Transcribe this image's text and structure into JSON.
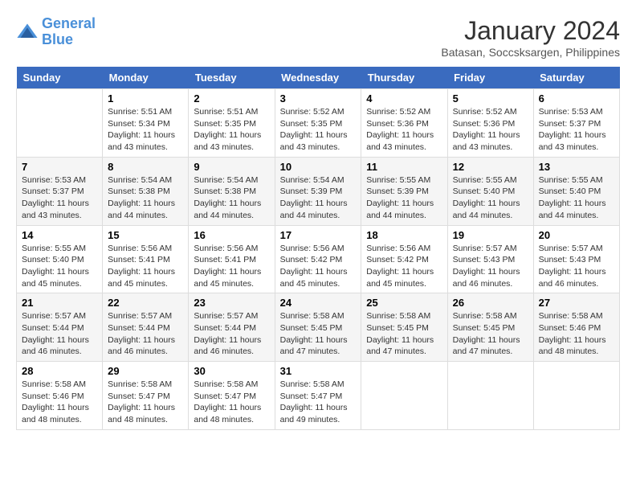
{
  "logo": {
    "line1": "General",
    "line2": "Blue"
  },
  "title": "January 2024",
  "subtitle": "Batasan, Soccsksargen, Philippines",
  "days_header": [
    "Sunday",
    "Monday",
    "Tuesday",
    "Wednesday",
    "Thursday",
    "Friday",
    "Saturday"
  ],
  "weeks": [
    [
      {
        "num": "",
        "info": ""
      },
      {
        "num": "1",
        "info": "Sunrise: 5:51 AM\nSunset: 5:34 PM\nDaylight: 11 hours\nand 43 minutes."
      },
      {
        "num": "2",
        "info": "Sunrise: 5:51 AM\nSunset: 5:35 PM\nDaylight: 11 hours\nand 43 minutes."
      },
      {
        "num": "3",
        "info": "Sunrise: 5:52 AM\nSunset: 5:35 PM\nDaylight: 11 hours\nand 43 minutes."
      },
      {
        "num": "4",
        "info": "Sunrise: 5:52 AM\nSunset: 5:36 PM\nDaylight: 11 hours\nand 43 minutes."
      },
      {
        "num": "5",
        "info": "Sunrise: 5:52 AM\nSunset: 5:36 PM\nDaylight: 11 hours\nand 43 minutes."
      },
      {
        "num": "6",
        "info": "Sunrise: 5:53 AM\nSunset: 5:37 PM\nDaylight: 11 hours\nand 43 minutes."
      }
    ],
    [
      {
        "num": "7",
        "info": "Sunrise: 5:53 AM\nSunset: 5:37 PM\nDaylight: 11 hours\nand 43 minutes."
      },
      {
        "num": "8",
        "info": "Sunrise: 5:54 AM\nSunset: 5:38 PM\nDaylight: 11 hours\nand 44 minutes."
      },
      {
        "num": "9",
        "info": "Sunrise: 5:54 AM\nSunset: 5:38 PM\nDaylight: 11 hours\nand 44 minutes."
      },
      {
        "num": "10",
        "info": "Sunrise: 5:54 AM\nSunset: 5:39 PM\nDaylight: 11 hours\nand 44 minutes."
      },
      {
        "num": "11",
        "info": "Sunrise: 5:55 AM\nSunset: 5:39 PM\nDaylight: 11 hours\nand 44 minutes."
      },
      {
        "num": "12",
        "info": "Sunrise: 5:55 AM\nSunset: 5:40 PM\nDaylight: 11 hours\nand 44 minutes."
      },
      {
        "num": "13",
        "info": "Sunrise: 5:55 AM\nSunset: 5:40 PM\nDaylight: 11 hours\nand 44 minutes."
      }
    ],
    [
      {
        "num": "14",
        "info": "Sunrise: 5:55 AM\nSunset: 5:40 PM\nDaylight: 11 hours\nand 45 minutes."
      },
      {
        "num": "15",
        "info": "Sunrise: 5:56 AM\nSunset: 5:41 PM\nDaylight: 11 hours\nand 45 minutes."
      },
      {
        "num": "16",
        "info": "Sunrise: 5:56 AM\nSunset: 5:41 PM\nDaylight: 11 hours\nand 45 minutes."
      },
      {
        "num": "17",
        "info": "Sunrise: 5:56 AM\nSunset: 5:42 PM\nDaylight: 11 hours\nand 45 minutes."
      },
      {
        "num": "18",
        "info": "Sunrise: 5:56 AM\nSunset: 5:42 PM\nDaylight: 11 hours\nand 45 minutes."
      },
      {
        "num": "19",
        "info": "Sunrise: 5:57 AM\nSunset: 5:43 PM\nDaylight: 11 hours\nand 46 minutes."
      },
      {
        "num": "20",
        "info": "Sunrise: 5:57 AM\nSunset: 5:43 PM\nDaylight: 11 hours\nand 46 minutes."
      }
    ],
    [
      {
        "num": "21",
        "info": "Sunrise: 5:57 AM\nSunset: 5:44 PM\nDaylight: 11 hours\nand 46 minutes."
      },
      {
        "num": "22",
        "info": "Sunrise: 5:57 AM\nSunset: 5:44 PM\nDaylight: 11 hours\nand 46 minutes."
      },
      {
        "num": "23",
        "info": "Sunrise: 5:57 AM\nSunset: 5:44 PM\nDaylight: 11 hours\nand 46 minutes."
      },
      {
        "num": "24",
        "info": "Sunrise: 5:58 AM\nSunset: 5:45 PM\nDaylight: 11 hours\nand 47 minutes."
      },
      {
        "num": "25",
        "info": "Sunrise: 5:58 AM\nSunset: 5:45 PM\nDaylight: 11 hours\nand 47 minutes."
      },
      {
        "num": "26",
        "info": "Sunrise: 5:58 AM\nSunset: 5:45 PM\nDaylight: 11 hours\nand 47 minutes."
      },
      {
        "num": "27",
        "info": "Sunrise: 5:58 AM\nSunset: 5:46 PM\nDaylight: 11 hours\nand 48 minutes."
      }
    ],
    [
      {
        "num": "28",
        "info": "Sunrise: 5:58 AM\nSunset: 5:46 PM\nDaylight: 11 hours\nand 48 minutes."
      },
      {
        "num": "29",
        "info": "Sunrise: 5:58 AM\nSunset: 5:47 PM\nDaylight: 11 hours\nand 48 minutes."
      },
      {
        "num": "30",
        "info": "Sunrise: 5:58 AM\nSunset: 5:47 PM\nDaylight: 11 hours\nand 48 minutes."
      },
      {
        "num": "31",
        "info": "Sunrise: 5:58 AM\nSunset: 5:47 PM\nDaylight: 11 hours\nand 49 minutes."
      },
      {
        "num": "",
        "info": ""
      },
      {
        "num": "",
        "info": ""
      },
      {
        "num": "",
        "info": ""
      }
    ]
  ]
}
